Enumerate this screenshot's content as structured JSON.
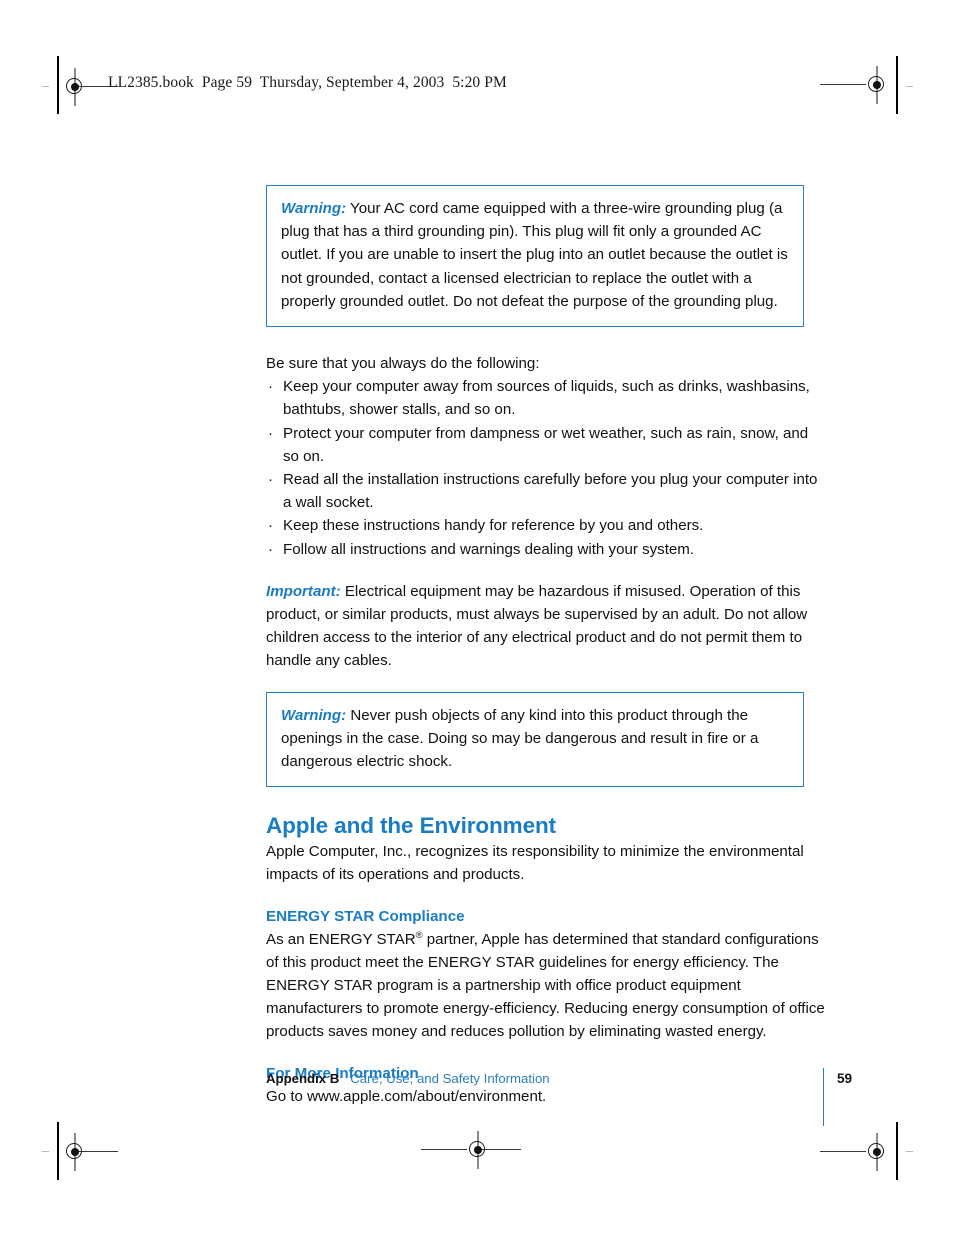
{
  "header": {
    "running_head": "LL2385.book  Page 59  Thursday, September 4, 2003  5:20 PM"
  },
  "content": {
    "warning_1": {
      "label": "Warning:",
      "text": " Your AC cord came equipped with a three-wire grounding plug (a plug that has a third grounding pin). This plug will fit only a grounded AC outlet. If you are unable to insert the plug into an outlet because the outlet is not grounded, contact a licensed electrician to replace the outlet with a properly grounded outlet. Do not defeat the purpose of the grounding plug."
    },
    "intro_line": "Be sure that you always do the following:",
    "bullet_marker": "·",
    "bullets": [
      "Keep your computer away from sources of liquids, such as drinks, washbasins, bathtubs, shower stalls, and so on.",
      "Protect your computer from dampness or wet weather, such as rain, snow, and so on.",
      "Read all the installation instructions carefully before you plug your computer into a wall socket.",
      "Keep these instructions handy for reference by you and others.",
      "Follow all instructions and warnings dealing with your system."
    ],
    "important": {
      "label": "Important:",
      "text": " Electrical equipment may be hazardous if misused. Operation of this product, or similar products, must always be supervised by an adult. Do not allow children access to the interior of any electrical product and do not permit them to handle any cables."
    },
    "warning_2": {
      "label": "Warning:",
      "text": " Never push objects of any kind into this product through the openings in the case. Doing so may be dangerous and result in fire or a dangerous electric shock."
    },
    "section": {
      "heading": "Apple and the Environment",
      "body": "Apple Computer, Inc., recognizes its responsibility to minimize the environmental impacts of its operations and products."
    },
    "energy_star": {
      "heading": "ENERGY STAR Compliance",
      "body_before_mark": "As an ENERGY STAR",
      "registered_mark": "®",
      "body_after_mark": " partner, Apple has determined that standard configurations of this product meet the ENERGY STAR guidelines for energy efficiency. The ENERGY STAR program is a partnership with office product equipment manufacturers to promote energy-efficiency. Reducing energy consumption of office products saves money and reduces pollution by eliminating wasted energy."
    },
    "more_info": {
      "heading": "For More Information",
      "body": "Go to www.apple.com/about/environment."
    }
  },
  "footer": {
    "appendix": "Appendix B",
    "chapter_title": "Care, Use, and Safety Information",
    "page_number": "59"
  },
  "colors": {
    "accent_blue": "#1a7cc4",
    "rule_blue": "#2a7fc1",
    "text_black": "#111111"
  }
}
